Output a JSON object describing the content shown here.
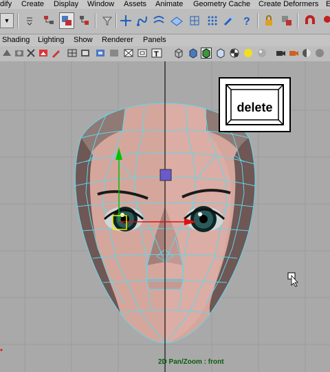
{
  "menubar": {
    "items": [
      "dify",
      "Create",
      "Display",
      "Window",
      "Assets",
      "Animate",
      "Geometry Cache",
      "Create Deformers",
      "E"
    ]
  },
  "panel_menu": {
    "items": [
      "Shading",
      "Lighting",
      "Show",
      "Renderer",
      "Panels"
    ]
  },
  "viewport": {
    "camera_label": "2D Pan/Zoom : front",
    "overlay_key_label": "delete"
  },
  "colors": {
    "wireframe": "#5fd8ee",
    "skin_light": "#d8a89e",
    "skin_dark": "#8a6a66",
    "axis_y": "#00c000",
    "axis_x": "#e01010",
    "manip_center": "#6a5acd",
    "status_text": "#0b5a0b"
  }
}
